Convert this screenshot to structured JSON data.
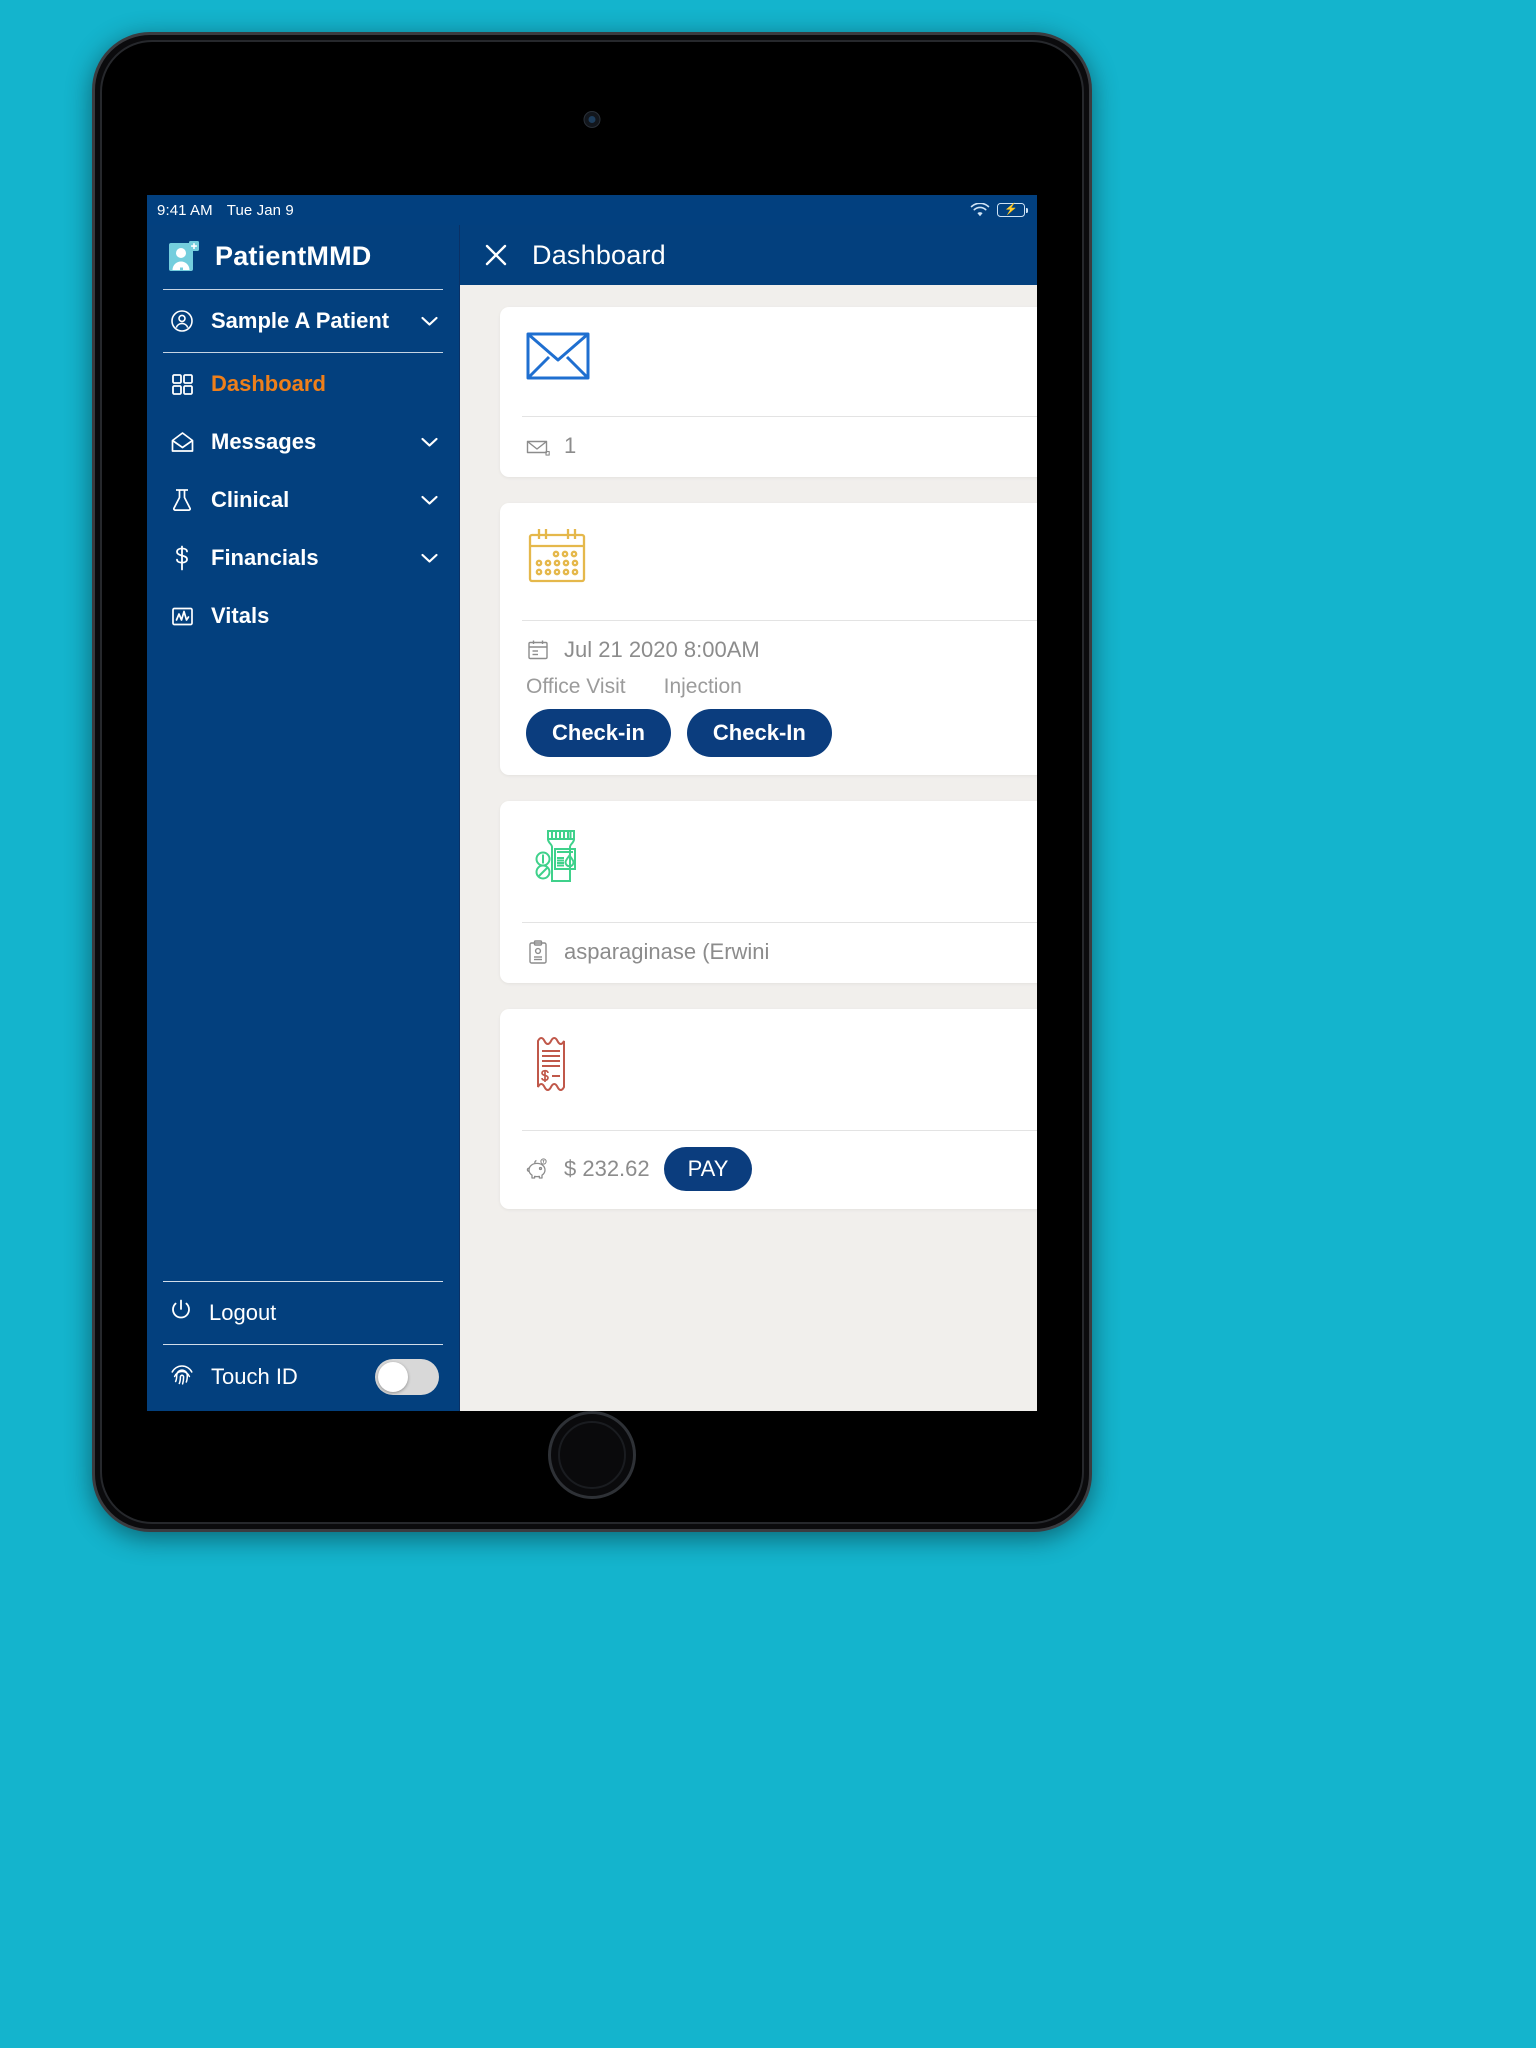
{
  "status_bar": {
    "time": "9:41 AM",
    "date": "Tue Jan 9",
    "wifi_icon": "wifi-icon",
    "battery_icon": "battery-charging-icon"
  },
  "sidebar": {
    "brand": {
      "logo_icon": "patient-card-icon",
      "name": "PatientMMD"
    },
    "patient": {
      "icon": "user-circle-icon",
      "label": "Sample A Patient",
      "chevron_icon": "chevron-down-icon"
    },
    "items": [
      {
        "label": "Dashboard",
        "icon": "grid-icon",
        "active": true,
        "chevron": false
      },
      {
        "label": "Messages",
        "icon": "envelope-icon",
        "active": false,
        "chevron": true
      },
      {
        "label": "Clinical",
        "icon": "flask-icon",
        "active": false,
        "chevron": true
      },
      {
        "label": "Financials",
        "icon": "dollar-icon",
        "active": false,
        "chevron": true
      },
      {
        "label": "Vitals",
        "icon": "chart-box-icon",
        "active": false,
        "chevron": false
      }
    ],
    "logout": {
      "label": "Logout",
      "icon": "power-icon"
    },
    "touch_id": {
      "label": "Touch ID",
      "icon": "fingerprint-icon",
      "enabled": false
    }
  },
  "topbar": {
    "close_icon": "close-icon",
    "title": "Dashboard"
  },
  "cards": {
    "messages": {
      "hero_icon": "envelope-outline-icon",
      "foot_icon": "mail-count-icon",
      "count": "1"
    },
    "appointment": {
      "hero_icon": "calendar-icon",
      "foot_icon": "calendar-small-icon",
      "datetime": "Jul 21 2020  8:00AM",
      "type_labels": [
        "Office Visit",
        "Injection"
      ],
      "buttons": [
        "Check-in",
        "Check-In"
      ]
    },
    "medication": {
      "hero_icon": "medicine-bottle-icon",
      "foot_icon": "prescription-clipboard-icon",
      "name": "asparaginase (Erwini"
    },
    "billing": {
      "hero_icon": "receipt-icon",
      "foot_icon": "piggy-bank-icon",
      "amount": "$ 232.62",
      "pay_label": "PAY"
    }
  },
  "colors": {
    "brand_blue": "#03407e",
    "accent_orange": "#ef7f1a",
    "background_teal": "#14b4cd",
    "card_bg": "#ffffff",
    "content_bg": "#f1efec",
    "envelope_blue": "#1f6fd0",
    "calendar_gold": "#e5b84b",
    "medicine_green": "#3fd18b",
    "receipt_red": "#c0584a"
  }
}
